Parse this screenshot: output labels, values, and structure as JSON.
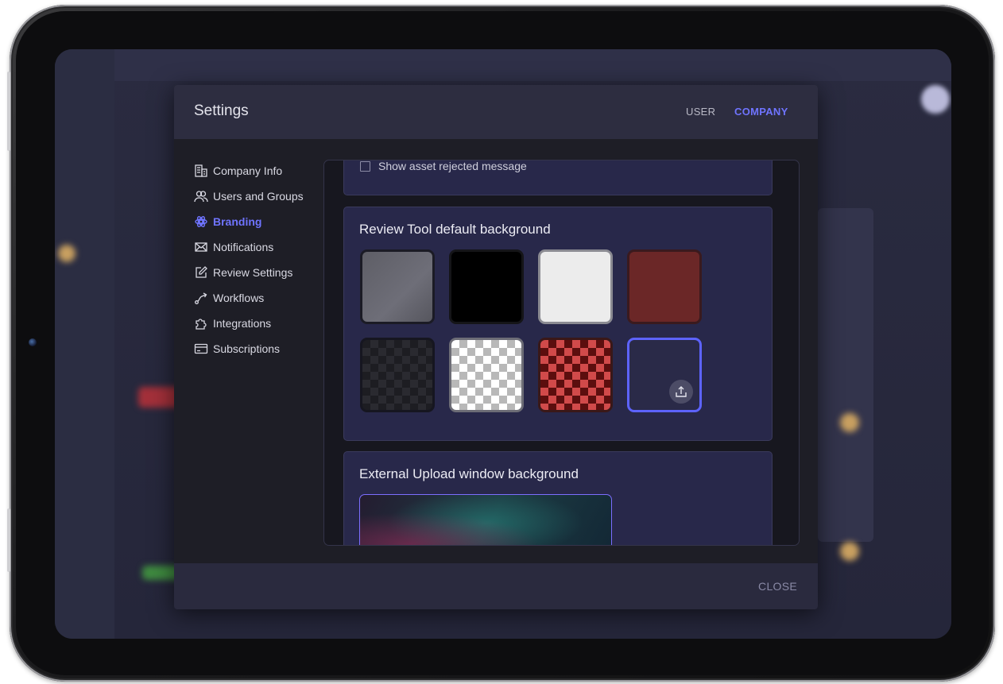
{
  "modal": {
    "title": "Settings",
    "tabs": [
      {
        "label": "USER",
        "active": false
      },
      {
        "label": "COMPANY",
        "active": true
      }
    ],
    "close_label": "CLOSE"
  },
  "sidebar": {
    "items": [
      {
        "label": "Company Info",
        "icon": "building-icon",
        "active": false
      },
      {
        "label": "Users and Groups",
        "icon": "users-icon",
        "active": false
      },
      {
        "label": "Branding",
        "icon": "branding-icon",
        "active": true
      },
      {
        "label": "Notifications",
        "icon": "envelope-icon",
        "active": false
      },
      {
        "label": "Review Settings",
        "icon": "edit-icon",
        "active": false
      },
      {
        "label": "Workflows",
        "icon": "workflow-icon",
        "active": false
      },
      {
        "label": "Integrations",
        "icon": "puzzle-icon",
        "active": false
      },
      {
        "label": "Subscriptions",
        "icon": "card-icon",
        "active": false
      }
    ]
  },
  "content": {
    "checkbox_label": "Show asset rejected message",
    "review_tool": {
      "title": "Review Tool default background",
      "swatches": [
        "gray",
        "black",
        "white",
        "dark-red",
        "dark-checker",
        "white-checker",
        "red-checker",
        "custom-upload"
      ],
      "selected": "custom-upload"
    },
    "external_upload": {
      "title": "External Upload window background"
    }
  },
  "colors": {
    "accent": "#6f74ff",
    "modal_bg": "#1e1e26",
    "header_bg": "#2d2d40",
    "card_bg": "#28284a"
  }
}
